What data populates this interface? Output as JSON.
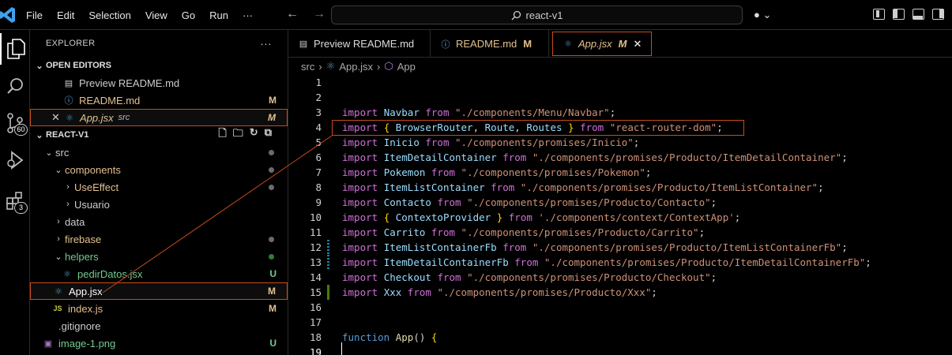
{
  "menu": [
    "File",
    "Edit",
    "Selection",
    "View",
    "Go",
    "Run",
    "···"
  ],
  "search": {
    "text": "react-v1"
  },
  "explorer": {
    "title": "EXPLORER",
    "more": "···",
    "open_editors": {
      "title": "OPEN EDITORS",
      "items": [
        {
          "name": "Preview README.md",
          "icon": "preview-icon"
        },
        {
          "name": "README.md",
          "status": "M",
          "icon": "info-icon"
        },
        {
          "name": "App.jsx",
          "sub": "src",
          "status": "M",
          "icon": "react-icon"
        }
      ]
    },
    "project": {
      "title": "REACT-V1",
      "tree": [
        {
          "name": "src",
          "type": "folder",
          "depth": 0
        },
        {
          "name": "components",
          "type": "folder",
          "depth": 1
        },
        {
          "name": "UseEffect",
          "type": "folder",
          "depth": 2
        },
        {
          "name": "Usuario",
          "type": "folder",
          "depth": 2
        },
        {
          "name": "data",
          "type": "folder",
          "depth": 1
        },
        {
          "name": "firebase",
          "type": "folder",
          "depth": 1
        },
        {
          "name": "helpers",
          "type": "folder",
          "depth": 1
        },
        {
          "name": "pedirDatos.jsx",
          "type": "file",
          "depth": 2,
          "status": "U"
        },
        {
          "name": "App.jsx",
          "type": "file",
          "depth": 1,
          "status": "M"
        },
        {
          "name": "index.js",
          "type": "file",
          "depth": 1,
          "status": "M",
          "prefix": "JS"
        },
        {
          "name": ".gitignore",
          "type": "file",
          "depth": 0
        },
        {
          "name": "image-1.png",
          "type": "file",
          "depth": 0,
          "status": "U"
        }
      ]
    }
  },
  "activity": {
    "scm_badge": "60",
    "ext_badge": "3"
  },
  "tabs": [
    {
      "label": "Preview README.md",
      "icon": "preview-icon"
    },
    {
      "label": "README.md",
      "status": "M",
      "icon": "info-icon"
    },
    {
      "label": "App.jsx",
      "status": "M",
      "icon": "react-icon",
      "close": "✕"
    }
  ],
  "breadcrumb": [
    "src",
    "App.jsx",
    "App"
  ],
  "code_lines": [
    {
      "n": "1",
      "parts": []
    },
    {
      "n": "2",
      "parts": []
    },
    {
      "n": "3",
      "parts": [
        [
          "kw2",
          "import"
        ],
        [
          "plain",
          " "
        ],
        [
          "id",
          "Navbar"
        ],
        [
          "plain",
          " "
        ],
        [
          "kw2",
          "from"
        ],
        [
          "plain",
          " "
        ],
        [
          "str",
          "\"./components/Menu/Navbar\""
        ],
        [
          "plain",
          ";"
        ]
      ]
    },
    {
      "n": "4",
      "parts": [
        [
          "kw2",
          "import"
        ],
        [
          "plain",
          " "
        ],
        [
          "brace",
          "{"
        ],
        [
          "plain",
          " "
        ],
        [
          "id",
          "BrowserRouter"
        ],
        [
          "plain",
          ", "
        ],
        [
          "id",
          "Route"
        ],
        [
          "plain",
          ", "
        ],
        [
          "id",
          "Routes"
        ],
        [
          "plain",
          " "
        ],
        [
          "brace",
          "}"
        ],
        [
          "plain",
          " "
        ],
        [
          "kw2",
          "from"
        ],
        [
          "plain",
          " "
        ],
        [
          "str",
          "\"react-router-dom\""
        ],
        [
          "plain",
          ";"
        ]
      ]
    },
    {
      "n": "5",
      "parts": [
        [
          "kw2",
          "import"
        ],
        [
          "plain",
          " "
        ],
        [
          "id",
          "Inicio"
        ],
        [
          "plain",
          " "
        ],
        [
          "kw2",
          "from"
        ],
        [
          "plain",
          " "
        ],
        [
          "str",
          "\"./components/promises/Inicio\""
        ],
        [
          "plain",
          ";"
        ]
      ]
    },
    {
      "n": "6",
      "parts": [
        [
          "kw2",
          "import"
        ],
        [
          "plain",
          " "
        ],
        [
          "id",
          "ItemDetailContainer"
        ],
        [
          "plain",
          " "
        ],
        [
          "kw2",
          "from"
        ],
        [
          "plain",
          " "
        ],
        [
          "str",
          "\"./components/promises/Producto/ItemDetailContainer\""
        ],
        [
          "plain",
          ";"
        ]
      ]
    },
    {
      "n": "7",
      "parts": [
        [
          "kw2",
          "import"
        ],
        [
          "plain",
          " "
        ],
        [
          "id",
          "Pokemon"
        ],
        [
          "plain",
          " "
        ],
        [
          "kw2",
          "from"
        ],
        [
          "plain",
          " "
        ],
        [
          "str",
          "\"./components/promises/Pokemon\""
        ],
        [
          "plain",
          ";"
        ]
      ]
    },
    {
      "n": "8",
      "parts": [
        [
          "kw2",
          "import"
        ],
        [
          "plain",
          " "
        ],
        [
          "id",
          "ItemListContainer"
        ],
        [
          "plain",
          " "
        ],
        [
          "kw2",
          "from"
        ],
        [
          "plain",
          " "
        ],
        [
          "str",
          "\"./components/promises/Producto/ItemListContainer\""
        ],
        [
          "plain",
          ";"
        ]
      ]
    },
    {
      "n": "9",
      "parts": [
        [
          "kw2",
          "import"
        ],
        [
          "plain",
          " "
        ],
        [
          "id",
          "Contacto"
        ],
        [
          "plain",
          " "
        ],
        [
          "kw2",
          "from"
        ],
        [
          "plain",
          " "
        ],
        [
          "str",
          "\"./components/promises/Producto/Contacto\""
        ],
        [
          "plain",
          ";"
        ]
      ]
    },
    {
      "n": "10",
      "parts": [
        [
          "kw2",
          "import"
        ],
        [
          "plain",
          " "
        ],
        [
          "brace",
          "{"
        ],
        [
          "plain",
          " "
        ],
        [
          "id",
          "ContextoProvider"
        ],
        [
          "plain",
          " "
        ],
        [
          "brace",
          "}"
        ],
        [
          "plain",
          " "
        ],
        [
          "kw2",
          "from"
        ],
        [
          "plain",
          " "
        ],
        [
          "str",
          "'./components/context/ContextApp'"
        ],
        [
          "plain",
          ";"
        ]
      ]
    },
    {
      "n": "11",
      "parts": [
        [
          "kw2",
          "import"
        ],
        [
          "plain",
          " "
        ],
        [
          "id",
          "Carrito"
        ],
        [
          "plain",
          " "
        ],
        [
          "kw2",
          "from"
        ],
        [
          "plain",
          " "
        ],
        [
          "str",
          "\"./components/promises/Producto/Carrito\""
        ],
        [
          "plain",
          ";"
        ]
      ]
    },
    {
      "n": "12",
      "parts": [
        [
          "kw2",
          "import"
        ],
        [
          "plain",
          " "
        ],
        [
          "id",
          "ItemListContainerFb"
        ],
        [
          "plain",
          " "
        ],
        [
          "kw2",
          "from"
        ],
        [
          "plain",
          " "
        ],
        [
          "str",
          "\"./components/promises/Producto/ItemListContainerFb\""
        ],
        [
          "plain",
          ";"
        ]
      ]
    },
    {
      "n": "13",
      "parts": [
        [
          "kw2",
          "import"
        ],
        [
          "plain",
          " "
        ],
        [
          "id",
          "ItemDetailContainerFb"
        ],
        [
          "plain",
          " "
        ],
        [
          "kw2",
          "from"
        ],
        [
          "plain",
          " "
        ],
        [
          "str",
          "\"./components/promises/Producto/ItemDetailContainerFb\""
        ],
        [
          "plain",
          ";"
        ]
      ]
    },
    {
      "n": "14",
      "parts": [
        [
          "kw2",
          "import"
        ],
        [
          "plain",
          " "
        ],
        [
          "id",
          "Checkout"
        ],
        [
          "plain",
          " "
        ],
        [
          "kw2",
          "from"
        ],
        [
          "plain",
          " "
        ],
        [
          "str",
          "\"./components/promises/Producto/Checkout\""
        ],
        [
          "plain",
          ";"
        ]
      ]
    },
    {
      "n": "15",
      "parts": [
        [
          "kw2",
          "import"
        ],
        [
          "plain",
          " "
        ],
        [
          "id",
          "Xxx"
        ],
        [
          "plain",
          " "
        ],
        [
          "kw2",
          "from"
        ],
        [
          "plain",
          " "
        ],
        [
          "str",
          "\"./components/promises/Producto/Xxx\""
        ],
        [
          "plain",
          ";"
        ]
      ]
    },
    {
      "n": "16",
      "parts": []
    },
    {
      "n": "17",
      "parts": []
    },
    {
      "n": "18",
      "parts": [
        [
          "kw",
          "function"
        ],
        [
          "plain",
          " "
        ],
        [
          "fn",
          "App"
        ],
        [
          "plain",
          "() "
        ],
        [
          "brace",
          "{"
        ]
      ]
    },
    {
      "n": "19",
      "parts": []
    }
  ],
  "colors": {
    "highlight_border": "#c74b1d",
    "modified": "#e2c08d",
    "untracked": "#73c991",
    "react_icon": "#519aba"
  }
}
